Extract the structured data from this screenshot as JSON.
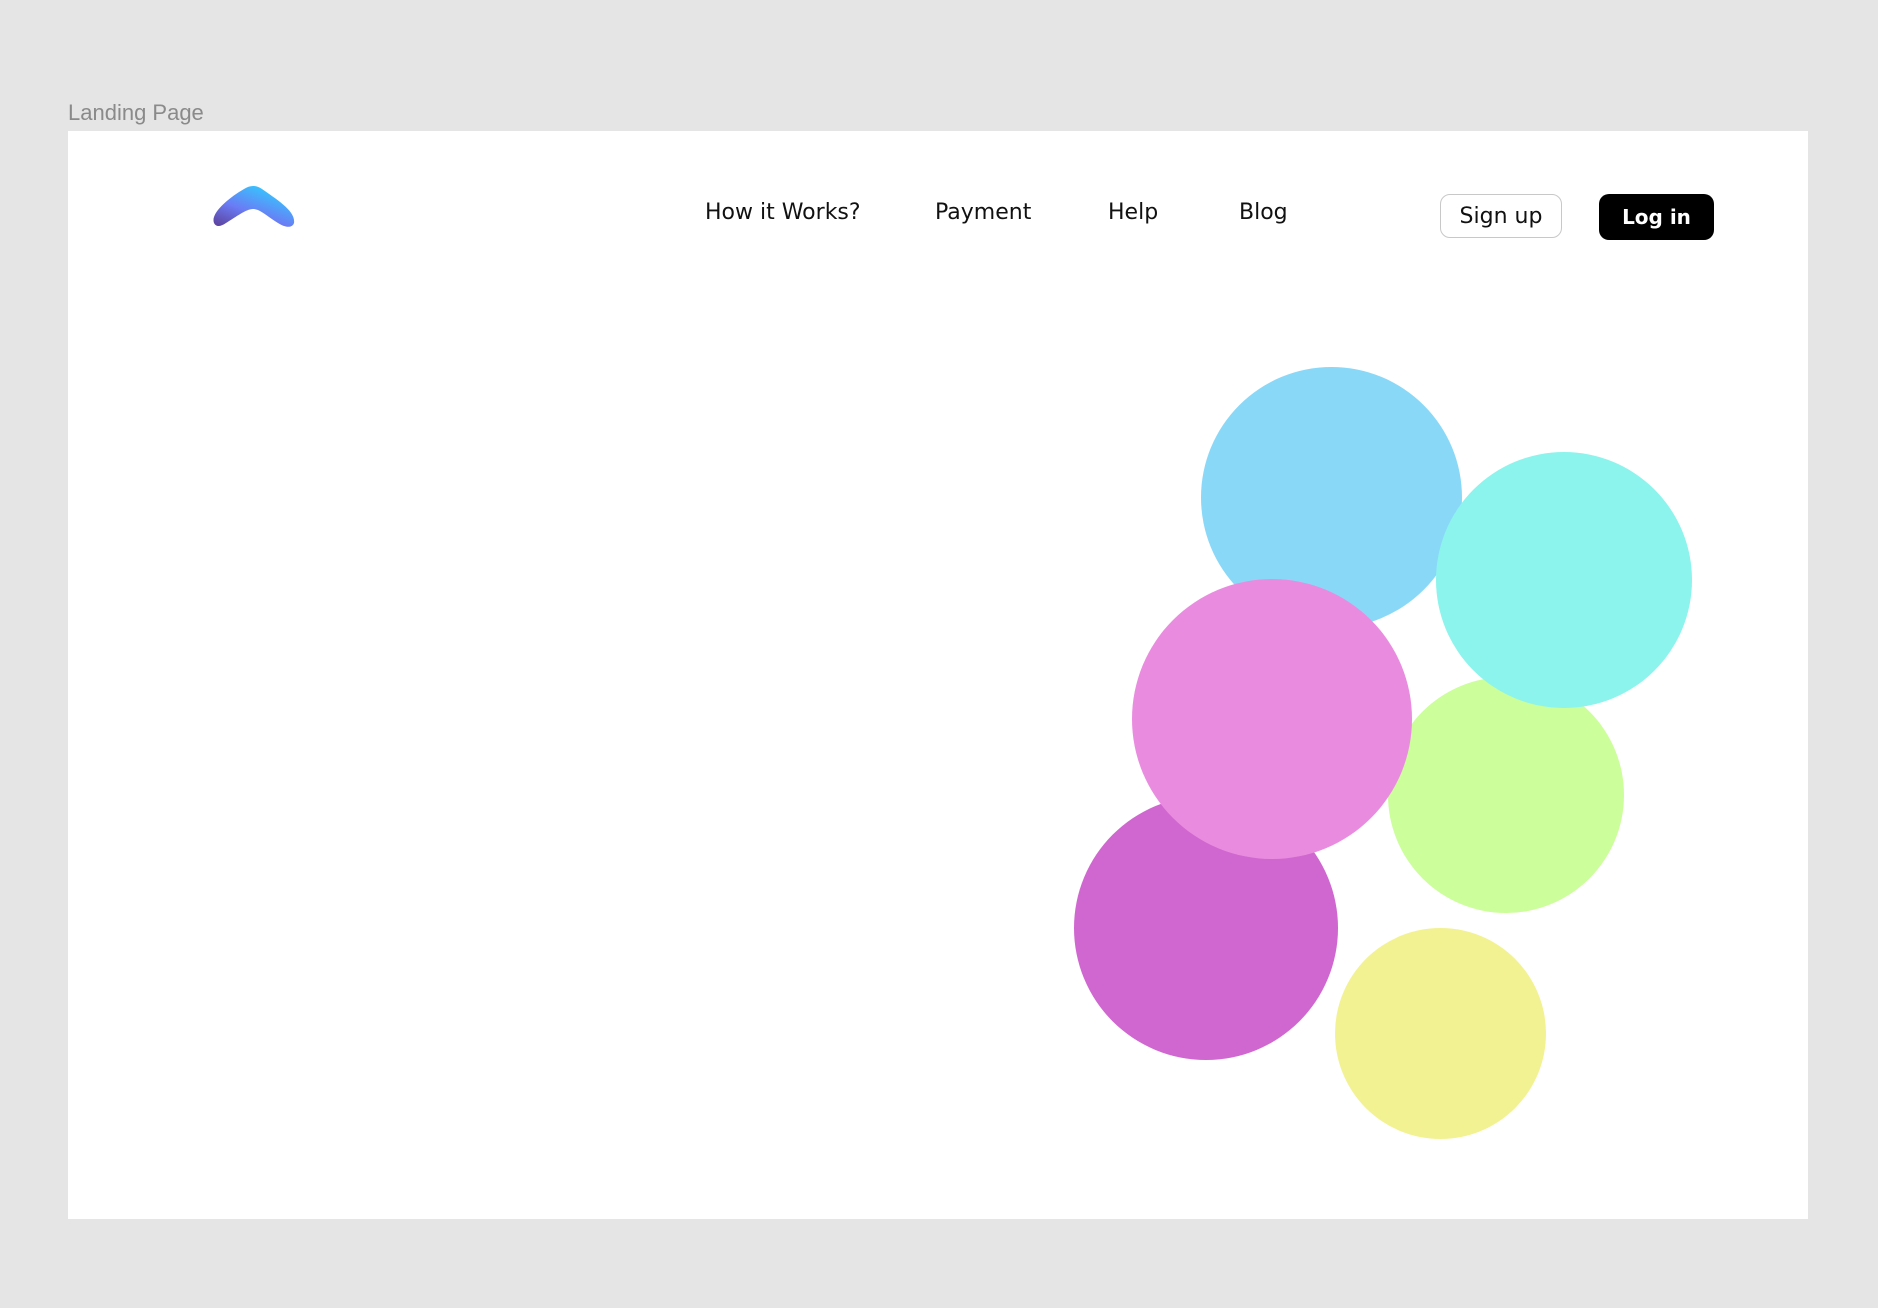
{
  "frame": {
    "label": "Landing Page"
  },
  "header": {
    "logo_icon": "chevron-up-logo-icon",
    "nav": [
      {
        "label": "How it Works?"
      },
      {
        "label": "Payment"
      },
      {
        "label": "Help"
      },
      {
        "label": "Blog"
      }
    ],
    "signup_label": "Sign up",
    "login_label": "Log in"
  },
  "colors": {
    "canvas_bg": "#e5e5e5",
    "page_bg": "#ffffff",
    "login_bg": "#000000",
    "logo_gradient": [
      "#2fd0ff",
      "#6a7cf5",
      "#5b3e96"
    ],
    "circles": {
      "sky_blue": "#8ad8f8",
      "aqua": "#8cf4ec",
      "pink": "#e98cdf",
      "light_green": "#ccfe9b",
      "magenta": "#d066cf",
      "yellow": "#f3f293"
    }
  }
}
